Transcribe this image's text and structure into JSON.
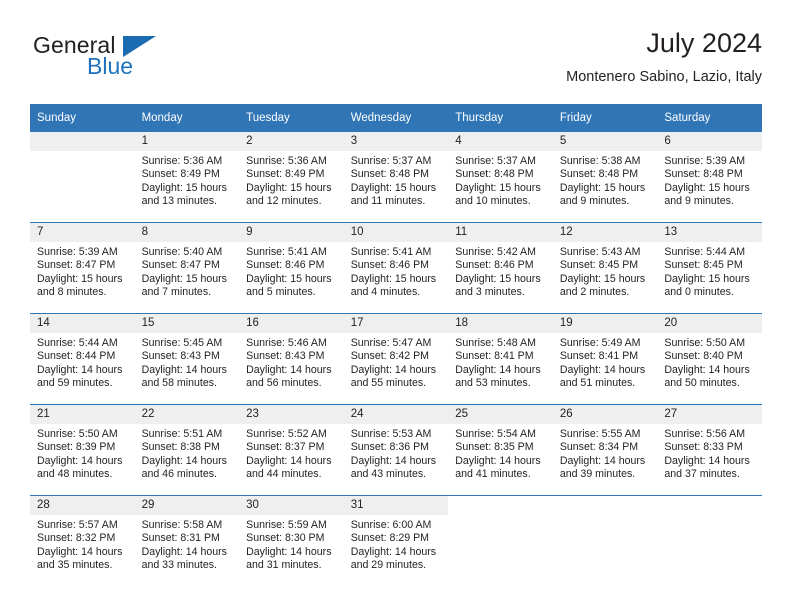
{
  "logo": {
    "word1": "General",
    "word2": "Blue",
    "triangle_color": "#1b6bb0",
    "blue_text_color": "#1f72bb"
  },
  "header": {
    "title": "July 2024",
    "subtitle": "Montenero Sabino, Lazio, Italy"
  },
  "theme": {
    "header_bg": "#3075b5",
    "header_text": "#ffffff",
    "daynum_bg": "#efefef",
    "row_border": "#3075b5",
    "body_text": "#231f20"
  },
  "weekdays": [
    "Sunday",
    "Monday",
    "Tuesday",
    "Wednesday",
    "Thursday",
    "Friday",
    "Saturday"
  ],
  "labels": {
    "sunrise": "Sunrise:",
    "sunset": "Sunset:",
    "daylight": "Daylight:"
  },
  "weeks": [
    [
      {
        "day": "",
        "empty": true
      },
      {
        "day": "1",
        "sunrise": "Sunrise: 5:36 AM",
        "sunset": "Sunset: 8:49 PM",
        "daylight_1": "Daylight: 15 hours",
        "daylight_2": "and 13 minutes."
      },
      {
        "day": "2",
        "sunrise": "Sunrise: 5:36 AM",
        "sunset": "Sunset: 8:49 PM",
        "daylight_1": "Daylight: 15 hours",
        "daylight_2": "and 12 minutes."
      },
      {
        "day": "3",
        "sunrise": "Sunrise: 5:37 AM",
        "sunset": "Sunset: 8:48 PM",
        "daylight_1": "Daylight: 15 hours",
        "daylight_2": "and 11 minutes."
      },
      {
        "day": "4",
        "sunrise": "Sunrise: 5:37 AM",
        "sunset": "Sunset: 8:48 PM",
        "daylight_1": "Daylight: 15 hours",
        "daylight_2": "and 10 minutes."
      },
      {
        "day": "5",
        "sunrise": "Sunrise: 5:38 AM",
        "sunset": "Sunset: 8:48 PM",
        "daylight_1": "Daylight: 15 hours",
        "daylight_2": "and 9 minutes."
      },
      {
        "day": "6",
        "sunrise": "Sunrise: 5:39 AM",
        "sunset": "Sunset: 8:48 PM",
        "daylight_1": "Daylight: 15 hours",
        "daylight_2": "and 9 minutes."
      }
    ],
    [
      {
        "day": "7",
        "sunrise": "Sunrise: 5:39 AM",
        "sunset": "Sunset: 8:47 PM",
        "daylight_1": "Daylight: 15 hours",
        "daylight_2": "and 8 minutes."
      },
      {
        "day": "8",
        "sunrise": "Sunrise: 5:40 AM",
        "sunset": "Sunset: 8:47 PM",
        "daylight_1": "Daylight: 15 hours",
        "daylight_2": "and 7 minutes."
      },
      {
        "day": "9",
        "sunrise": "Sunrise: 5:41 AM",
        "sunset": "Sunset: 8:46 PM",
        "daylight_1": "Daylight: 15 hours",
        "daylight_2": "and 5 minutes."
      },
      {
        "day": "10",
        "sunrise": "Sunrise: 5:41 AM",
        "sunset": "Sunset: 8:46 PM",
        "daylight_1": "Daylight: 15 hours",
        "daylight_2": "and 4 minutes."
      },
      {
        "day": "11",
        "sunrise": "Sunrise: 5:42 AM",
        "sunset": "Sunset: 8:46 PM",
        "daylight_1": "Daylight: 15 hours",
        "daylight_2": "and 3 minutes."
      },
      {
        "day": "12",
        "sunrise": "Sunrise: 5:43 AM",
        "sunset": "Sunset: 8:45 PM",
        "daylight_1": "Daylight: 15 hours",
        "daylight_2": "and 2 minutes."
      },
      {
        "day": "13",
        "sunrise": "Sunrise: 5:44 AM",
        "sunset": "Sunset: 8:45 PM",
        "daylight_1": "Daylight: 15 hours",
        "daylight_2": "and 0 minutes."
      }
    ],
    [
      {
        "day": "14",
        "sunrise": "Sunrise: 5:44 AM",
        "sunset": "Sunset: 8:44 PM",
        "daylight_1": "Daylight: 14 hours",
        "daylight_2": "and 59 minutes."
      },
      {
        "day": "15",
        "sunrise": "Sunrise: 5:45 AM",
        "sunset": "Sunset: 8:43 PM",
        "daylight_1": "Daylight: 14 hours",
        "daylight_2": "and 58 minutes."
      },
      {
        "day": "16",
        "sunrise": "Sunrise: 5:46 AM",
        "sunset": "Sunset: 8:43 PM",
        "daylight_1": "Daylight: 14 hours",
        "daylight_2": "and 56 minutes."
      },
      {
        "day": "17",
        "sunrise": "Sunrise: 5:47 AM",
        "sunset": "Sunset: 8:42 PM",
        "daylight_1": "Daylight: 14 hours",
        "daylight_2": "and 55 minutes."
      },
      {
        "day": "18",
        "sunrise": "Sunrise: 5:48 AM",
        "sunset": "Sunset: 8:41 PM",
        "daylight_1": "Daylight: 14 hours",
        "daylight_2": "and 53 minutes."
      },
      {
        "day": "19",
        "sunrise": "Sunrise: 5:49 AM",
        "sunset": "Sunset: 8:41 PM",
        "daylight_1": "Daylight: 14 hours",
        "daylight_2": "and 51 minutes."
      },
      {
        "day": "20",
        "sunrise": "Sunrise: 5:50 AM",
        "sunset": "Sunset: 8:40 PM",
        "daylight_1": "Daylight: 14 hours",
        "daylight_2": "and 50 minutes."
      }
    ],
    [
      {
        "day": "21",
        "sunrise": "Sunrise: 5:50 AM",
        "sunset": "Sunset: 8:39 PM",
        "daylight_1": "Daylight: 14 hours",
        "daylight_2": "and 48 minutes."
      },
      {
        "day": "22",
        "sunrise": "Sunrise: 5:51 AM",
        "sunset": "Sunset: 8:38 PM",
        "daylight_1": "Daylight: 14 hours",
        "daylight_2": "and 46 minutes."
      },
      {
        "day": "23",
        "sunrise": "Sunrise: 5:52 AM",
        "sunset": "Sunset: 8:37 PM",
        "daylight_1": "Daylight: 14 hours",
        "daylight_2": "and 44 minutes."
      },
      {
        "day": "24",
        "sunrise": "Sunrise: 5:53 AM",
        "sunset": "Sunset: 8:36 PM",
        "daylight_1": "Daylight: 14 hours",
        "daylight_2": "and 43 minutes."
      },
      {
        "day": "25",
        "sunrise": "Sunrise: 5:54 AM",
        "sunset": "Sunset: 8:35 PM",
        "daylight_1": "Daylight: 14 hours",
        "daylight_2": "and 41 minutes."
      },
      {
        "day": "26",
        "sunrise": "Sunrise: 5:55 AM",
        "sunset": "Sunset: 8:34 PM",
        "daylight_1": "Daylight: 14 hours",
        "daylight_2": "and 39 minutes."
      },
      {
        "day": "27",
        "sunrise": "Sunrise: 5:56 AM",
        "sunset": "Sunset: 8:33 PM",
        "daylight_1": "Daylight: 14 hours",
        "daylight_2": "and 37 minutes."
      }
    ],
    [
      {
        "day": "28",
        "sunrise": "Sunrise: 5:57 AM",
        "sunset": "Sunset: 8:32 PM",
        "daylight_1": "Daylight: 14 hours",
        "daylight_2": "and 35 minutes."
      },
      {
        "day": "29",
        "sunrise": "Sunrise: 5:58 AM",
        "sunset": "Sunset: 8:31 PM",
        "daylight_1": "Daylight: 14 hours",
        "daylight_2": "and 33 minutes."
      },
      {
        "day": "30",
        "sunrise": "Sunrise: 5:59 AM",
        "sunset": "Sunset: 8:30 PM",
        "daylight_1": "Daylight: 14 hours",
        "daylight_2": "and 31 minutes."
      },
      {
        "day": "31",
        "sunrise": "Sunrise: 6:00 AM",
        "sunset": "Sunset: 8:29 PM",
        "daylight_1": "Daylight: 14 hours",
        "daylight_2": "and 29 minutes."
      },
      {
        "day": "",
        "blank": true
      },
      {
        "day": "",
        "blank": true
      },
      {
        "day": "",
        "blank": true
      }
    ]
  ]
}
